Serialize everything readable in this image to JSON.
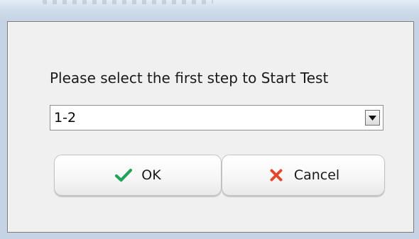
{
  "dialog": {
    "prompt": "Please select the first step to Start Test",
    "step_select": {
      "value": "1-2"
    },
    "ok_button": {
      "label": "OK",
      "icon": "check-icon"
    },
    "cancel_button": {
      "label": "Cancel",
      "icon": "x-icon"
    }
  },
  "colors": {
    "ok_icon": "#23a35a",
    "cancel_icon": "#e2482e",
    "dialog_bg": "#f0f0f0",
    "frame": "#c5d3e4"
  }
}
